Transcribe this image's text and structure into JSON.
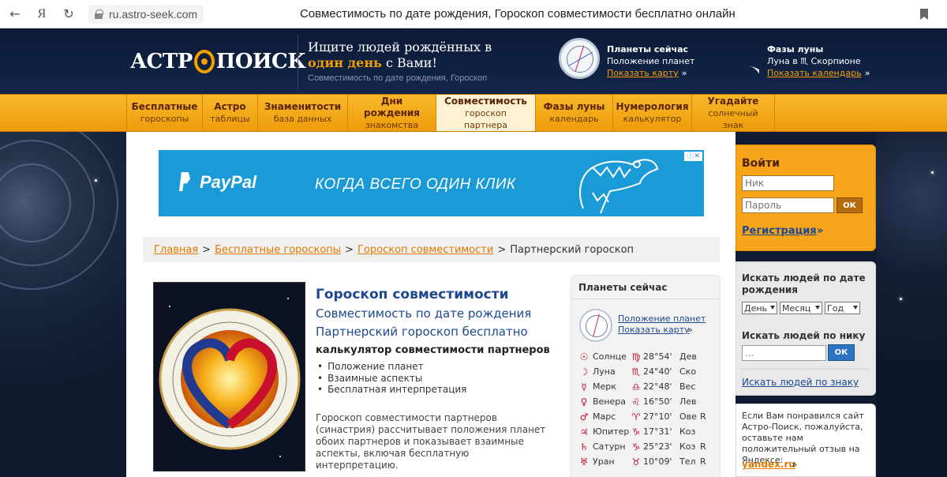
{
  "browser": {
    "url": "ru.astro-seek.com",
    "title": "Совместимость по дате рождения, Гороскоп совместимости бесплатно онлайн",
    "yandex_letter": "Я"
  },
  "header": {
    "logo_left": "АСТР",
    "logo_right": "ПОИСК",
    "slogan_line1": "Ищите людей рождённых в",
    "slogan_highlight": "один день",
    "slogan_rest": "с Вами!",
    "slogan_sub": "Совместимость по дате рождения, Гороскоп",
    "planets_title": "Планеты сейчас",
    "planets_sub": "Положение планет",
    "planets_link": "Показать карту",
    "moon_title": "Фазы луны",
    "moon_sub": "Луна в ♏ Скорпионе",
    "moon_link": "Показать календарь",
    "arrow": "»"
  },
  "nav": [
    {
      "a": "Бесплатные",
      "b": "гороскопы"
    },
    {
      "a": "Астро",
      "b": "таблицы"
    },
    {
      "a": "Знаменитости",
      "b": "база данных"
    },
    {
      "a": "Дни рождения",
      "b": "знакомства"
    },
    {
      "a": "Совместимость",
      "b": "гороскоп партнера"
    },
    {
      "a": "Фазы луны",
      "b": "календарь"
    },
    {
      "a": "Нумерология",
      "b": "калькулятор"
    },
    {
      "a": "Угадайте",
      "b": "солнечный знак"
    }
  ],
  "ad": {
    "brand": "PayPal",
    "slogan": "КОГДА ВСЕГО ОДИН КЛИК"
  },
  "breadcrumb": {
    "home": "Главная",
    "free": "Бесплатные гороскопы",
    "compat": "Гороскоп совместимости",
    "current": "Партнерский гороскоп",
    "sep": ">"
  },
  "content": {
    "title": "Гороскоп совместимости",
    "subtitle1": "Совместимость по дате рождения",
    "subtitle2": "Партнерский гороскоп бесплатно",
    "calc_title": "калькулятор совместимости партнеров",
    "bullets": [
      "Положение планет",
      "Взаимные аспекты",
      "Бесплатная интерпретация"
    ],
    "description": "Гороскоп совместимости партнеров (синастрия) рассчитывает положения планет обоих партнеров и показывает взаимные аспекты, включая бесплатную интерпретацию."
  },
  "planets_box": {
    "title": "Планеты сейчас",
    "link1": "Положение планет",
    "link2": "Показать карту",
    "arrow": "»",
    "rows": [
      {
        "sym": "☉",
        "name": "Солнце",
        "zsym": "♍",
        "deg": "28°54'",
        "zn": "Дев",
        "r": ""
      },
      {
        "sym": "☽",
        "name": "Луна",
        "zsym": "♏",
        "deg": "24°40'",
        "zn": "Ско",
        "r": ""
      },
      {
        "sym": "☿",
        "name": "Мерк",
        "zsym": "♎",
        "deg": "22°48'",
        "zn": "Вес",
        "r": ""
      },
      {
        "sym": "♀",
        "name": "Венера",
        "zsym": "♌",
        "deg": "16°50'",
        "zn": "Лев",
        "r": ""
      },
      {
        "sym": "♂",
        "name": "Марс",
        "zsym": "♈",
        "deg": "27°10'",
        "zn": "Ове",
        "r": "R"
      },
      {
        "sym": "♃",
        "name": "Юпитер",
        "zsym": "♑",
        "deg": "17°31'",
        "zn": "Коз",
        "r": ""
      },
      {
        "sym": "♄",
        "name": "Сатурн",
        "zsym": "♑",
        "deg": "25°23'",
        "zn": "Коз",
        "r": "R"
      },
      {
        "sym": "♅",
        "name": "Уран",
        "zsym": "♉",
        "deg": "10°09'",
        "zn": "Тел",
        "r": "R"
      }
    ]
  },
  "login": {
    "title": "Войти",
    "nick_placeholder": "Ник",
    "pass_placeholder": "Пароль",
    "ok": "ОК",
    "register": "Регистрация",
    "arrow": "»"
  },
  "search": {
    "by_date_title": "Искать людей по дате рождения",
    "day": "День",
    "month": "Месяц",
    "year": "Год",
    "by_nick_title": "Искать людей по нику",
    "nick_value": "...",
    "ok": "ОК",
    "by_sign_link": "Искать людей по знаку"
  },
  "yandex": {
    "text": "Если Вам понравился сайт Астро-Поиск, пожалуйста, оставьте нам положительный отзыв на Яндексе:",
    "link": "yandex.ru",
    "arrow": "»"
  },
  "colors": {
    "accent": "#f9a51b",
    "header_bg": "#0b1a36",
    "link": "#1d4890",
    "orange_link": "#e07a00"
  }
}
